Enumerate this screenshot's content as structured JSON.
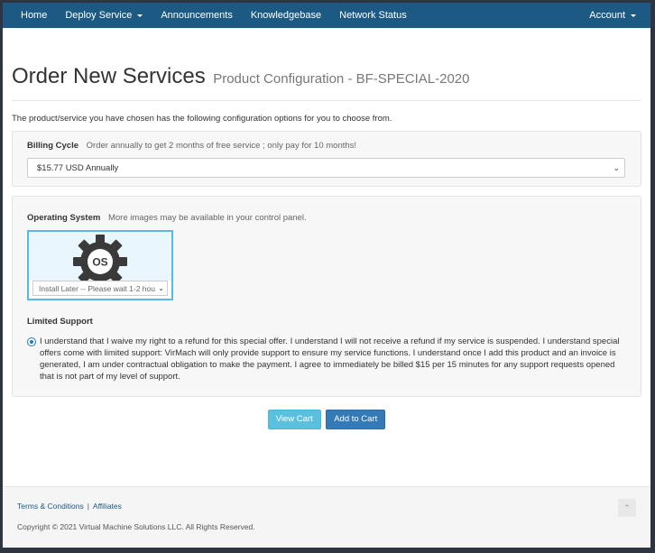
{
  "nav": {
    "home": "Home",
    "deploy_service": "Deploy Service",
    "announcements": "Announcements",
    "knowledgebase": "Knowledgebase",
    "network_status": "Network Status",
    "account": "Account"
  },
  "header": {
    "title": "Order New Services",
    "subtitle": "Product Configuration - BF-SPECIAL-2020"
  },
  "intro": "The product/service you have chosen has the following configuration options for you to choose from.",
  "billing": {
    "label": "Billing Cycle",
    "hint": "Order annually to get 2 months of free service ; only pay for 10 months!",
    "selected": "$15.77 USD Annually"
  },
  "os": {
    "label": "Operating System",
    "hint": "More images may be available in your control panel.",
    "badge": "OS",
    "selected": "Install Later -- Please wait 1-2 hou"
  },
  "limited_support": {
    "title": "Limited Support",
    "text": "I understand that I waive my right to a refund for this special offer. I understand I will not receive a refund if my service is suspended. I understand special offers come with limited support: VirMach will only provide support to ensure my service functions. I understand once I add this product and an invoice is generated, I am under contractual obligation to make the payment. I agree to immediately be billed $15 per 15 minutes for any support requests opened that is not part of my level of support."
  },
  "buttons": {
    "view_cart": "View Cart",
    "add_to_cart": "Add to Cart"
  },
  "footer": {
    "terms": "Terms & Conditions",
    "separator": "|",
    "affiliates": "Affiliates",
    "copyright": "Copyright © 2021 Virtual Machine Solutions LLC. All Rights Reserved."
  },
  "colors": {
    "navbar": "#1c5a84",
    "accent": "#337ab7",
    "info": "#5bc0de"
  },
  "icons": {
    "gear": "gear-os-icon",
    "back_to_top": "chevron-up-icon",
    "dropdown": "chevron-down-icon"
  }
}
